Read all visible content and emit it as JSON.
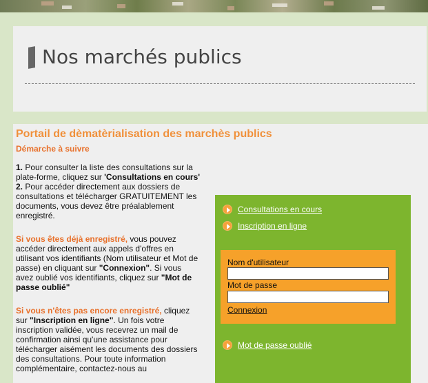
{
  "header": {
    "title": "Nos marchés publics"
  },
  "portal": {
    "title": "Portail de dèmatèrialisation des marchès publics",
    "subtitle": "Démarche à suivre"
  },
  "instructions": {
    "step1_num": "1.",
    "step1_text": " Pour consulter la liste des consultations sur la plate-forme, cliquez sur ",
    "step1_bold": "'Consultations en cours'",
    "step2_num": "2.",
    "step2_text": " Pour accéder directement aux dossiers de consultations et télécharger GRATUITEMENT les documents, vous devez être préalablement enregistré.",
    "registered_lead": "Si vous êtes déjà enregistré,",
    "registered_text1": " vous pouvez accéder directement aux appels d'offres en utilisant vos identifiants (Nom utilisateur et Mot de passe) en cliquant sur ",
    "registered_bold1": "\"Connexion\"",
    "registered_text2": ". Si vous avez oublié vos identifiants, cliquez sur ",
    "registered_bold2": "\"Mot de passe oublié\"",
    "notregistered_lead": "Si vous n'êtes pas encore enregistré,",
    "notregistered_text1": " cliquez sur ",
    "notregistered_bold": "\"Inscription en ligne\"",
    "notregistered_text2": ". Un fois votre inscription validée, vous recevrez un mail de confirmation ainsi qu'une assistance pour télécharger aisément les documents des dossiers des consultations. Pour toute information complémentaire, contactez-nous au"
  },
  "panel": {
    "link_consultations": "Consultations en cours",
    "link_inscription": "Inscription en ligne",
    "username_label": "Nom d'utilisateur",
    "password_label": "Mot de passe",
    "connexion": "Connexion",
    "forgot_password": "Mot de passe oublié"
  },
  "colors": {
    "accent_orange": "#f0903a",
    "panel_green": "#7db52e",
    "login_orange": "#f6a12a"
  }
}
